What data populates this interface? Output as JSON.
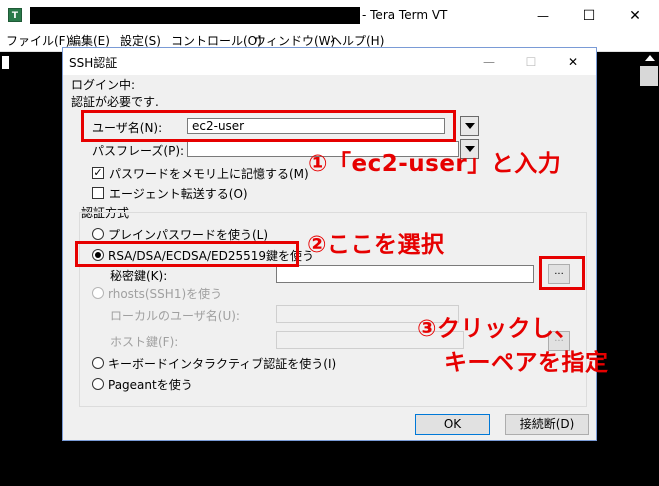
{
  "window": {
    "icon_label": "T",
    "title": "- Tera Term VT",
    "controls": {
      "minimize": "—",
      "maximize": "☐",
      "close": "✕"
    }
  },
  "menu": [
    "ファイル(F)",
    "編集(E)",
    "設定(S)",
    "コントロール(O)",
    "ウィンドウ(W)",
    "ヘルプ(H)"
  ],
  "dialog": {
    "title": "SSH認証",
    "controls": {
      "minimize": "—",
      "maximize": "☐",
      "close": "✕"
    },
    "login_label": "ログイン中:",
    "auth_required": "認証が必要です.",
    "username_label": "ユーザ名(N):",
    "username_value": "ec2-user",
    "passphrase_label": "パスフレーズ(P):",
    "passphrase_value": "",
    "remember_password": {
      "label": "パスワードをメモリ上に記憶する(M)",
      "checked": true,
      "mark": "✓"
    },
    "agent_forward": {
      "label": "エージェント転送する(O)",
      "checked": false
    },
    "auth_method_group": "認証方式",
    "methods": {
      "plain": "プレインパスワードを使う(L)",
      "rsa": "RSA/DSA/ECDSA/ED25519鍵を使う",
      "private_key_label": "秘密鍵(K):",
      "rhosts": "rhosts(SSH1)を使う",
      "local_user_label": "ローカルのユーザ名(U):",
      "host_key_label": "ホスト鍵(F):",
      "keyboard_interactive": "キーボードインタラクティブ認証を使う(I)",
      "pageant": "Pageantを使う"
    },
    "browse_label": "...",
    "ok_label": "OK",
    "disconnect_label": "接続断(D)"
  },
  "annotations": {
    "step1": "①「ec2-user」と入力",
    "step2": "②ここを選択",
    "step3_line1": "③クリックし、",
    "step3_line2": "キーペアを指定"
  },
  "colors": {
    "annotation": "#e60000",
    "terminal_bg": "#000000",
    "dialog_bg": "#f0f0f0"
  }
}
